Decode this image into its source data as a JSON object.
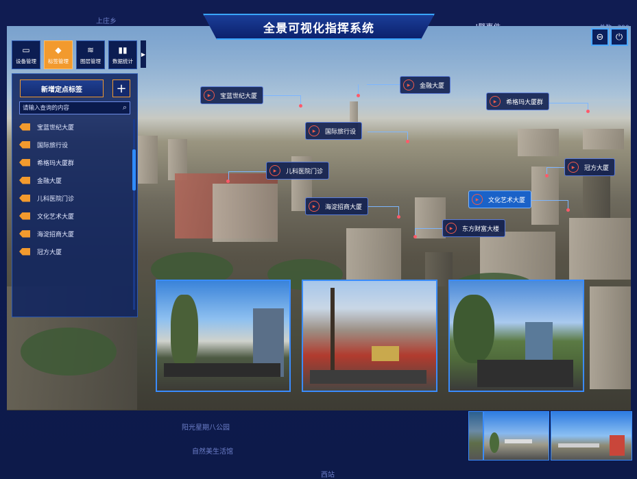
{
  "app": {
    "title": "全景可视化指挥系统"
  },
  "map_labels": {
    "top": "上庄乡",
    "park": "阳光星期八公园",
    "life": "自然美生活馆",
    "west": "西站"
  },
  "top_partial": {
    "event": "!警事件",
    "count": "总数 · 290"
  },
  "window_controls": {
    "zoom_out_icon": "minus-circle-icon",
    "power_icon": "power-icon"
  },
  "toolbar": {
    "items": [
      {
        "label": "设备管理",
        "icon": "device-icon",
        "active": false
      },
      {
        "label": "标签管理",
        "icon": "tag-icon",
        "active": true
      },
      {
        "label": "图层管理",
        "icon": "layers-icon",
        "active": false
      },
      {
        "label": "数据统计",
        "icon": "bar-chart-icon",
        "active": false
      }
    ]
  },
  "panel": {
    "add_button": "新增定点标签",
    "search_placeholder": "请输入查询的内容",
    "tags": [
      "宝蓝世纪大厦",
      "国际旅行设",
      "希格玛大厦群",
      "金融大厦",
      "儿科医院门诊",
      "文化艺术大厦",
      "海淀招商大厦",
      "冠方大厦"
    ]
  },
  "markers": [
    {
      "label": "宝蓝世纪大厦",
      "highlight": false
    },
    {
      "label": "金融大厦",
      "highlight": false
    },
    {
      "label": "希格玛大厦群",
      "highlight": false
    },
    {
      "label": "国际旅行设",
      "highlight": false
    },
    {
      "label": "儿科医院门诊",
      "highlight": false
    },
    {
      "label": "冠方大厦",
      "highlight": false
    },
    {
      "label": "文化艺术大厦",
      "highlight": true
    },
    {
      "label": "海淀招商大厦",
      "highlight": false
    },
    {
      "label": "东方财富大楼",
      "highlight": false
    }
  ],
  "colors": {
    "accent_orange": "#f29a2e",
    "accent_blue": "#39a6ff",
    "marker_dot": "#ff5a6a",
    "background": "#0d1b4a"
  }
}
